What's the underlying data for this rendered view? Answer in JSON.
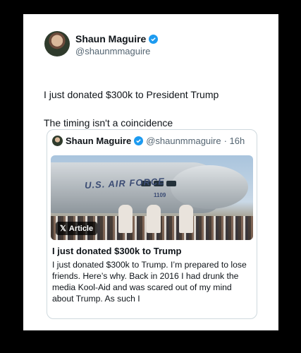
{
  "post": {
    "author_name": "Shaun Maguire",
    "author_handle": "@shaunmmaguire",
    "text_line1": "I just donated $300k to President Trump",
    "text_line2": "The timing isn't a coincidence"
  },
  "quote": {
    "author_name": "Shaun Maguire",
    "author_handle": "@shaunmmaguire",
    "time": "· 16h",
    "image_text": "U.S. AIR FORCE",
    "image_number": "1109",
    "badge_label": "Article",
    "title": "I just donated $300k to Trump",
    "body": "I just donated $300k to Trump. I’m prepared to lose friends. Here’s why. Back in 2016 I had drunk the media Kool-Aid and was scared out of my mind about Trump. As such I"
  },
  "colors": {
    "verified": "#1d9bf0",
    "text": "#0f1419",
    "muted": "#536471"
  }
}
